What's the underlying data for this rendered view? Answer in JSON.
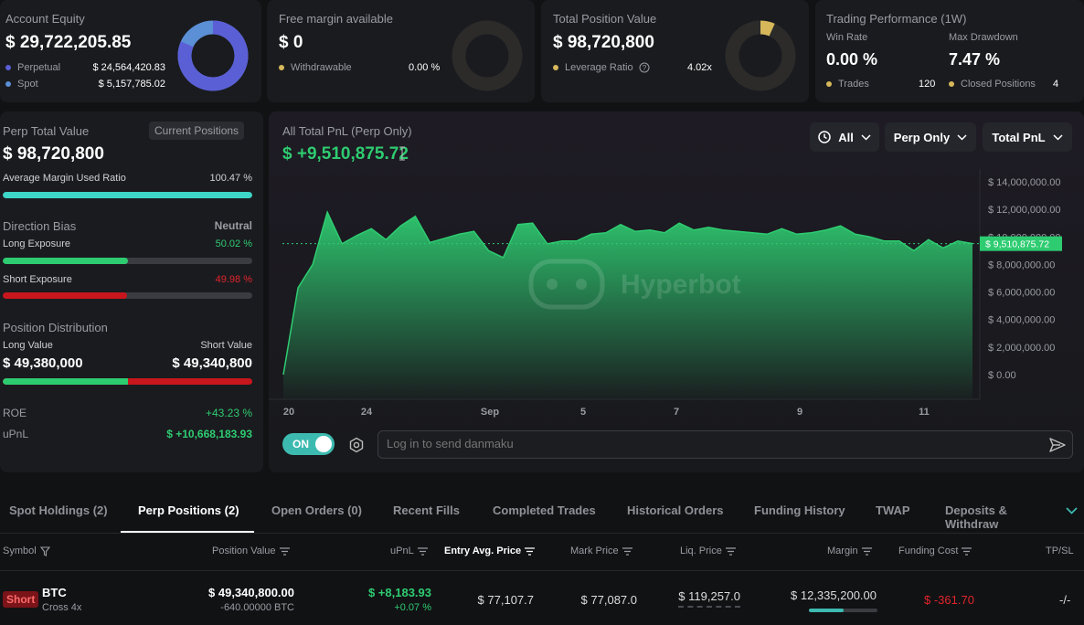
{
  "equity": {
    "title": "Account Equity",
    "value": "$ 29,722,205.85",
    "perp_label": "Perpetual",
    "perp_value": "$ 24,564,420.83",
    "spot_label": "Spot",
    "spot_value": "$ 5,157,785.02",
    "perp_fraction": 0.826,
    "perp_color": "#5b5fd6",
    "spot_color": "#5b8fd6"
  },
  "margin": {
    "title": "Free margin available",
    "value": "$ 0",
    "withdrawable_label": "Withdrawable",
    "withdrawable_value": "0.00 %"
  },
  "position_value": {
    "title": "Total Position Value",
    "value": "$ 98,720,800",
    "leverage_label": "Leverage Ratio",
    "leverage_value": "4.02x"
  },
  "performance": {
    "title": "Trading Performance (1W)",
    "win_rate_label": "Win Rate",
    "win_rate_value": "0.00 %",
    "drawdown_label": "Max Drawdown",
    "drawdown_value": "7.47 %",
    "trades_label": "Trades",
    "trades_value": "120",
    "closed_label": "Closed Positions",
    "closed_value": "4"
  },
  "perp": {
    "title": "Perp Total Value",
    "current_positions": "Current Positions",
    "value": "$ 98,720,800",
    "avg_margin_label": "Average Margin Used Ratio",
    "avg_margin_value": "100.47 %",
    "avg_margin_fraction": 1.0,
    "direction_label": "Direction Bias",
    "direction_value": "Neutral",
    "long_label": "Long Exposure",
    "long_value": "50.02 %",
    "long_fraction": 0.5002,
    "short_label": "Short Exposure",
    "short_value": "49.98 %",
    "short_fraction": 0.4998,
    "distribution_label": "Position Distribution",
    "long_value_label": "Long Value",
    "short_value_label": "Short Value",
    "long_amount": "$ 49,380,000",
    "short_amount": "$ 49,340,800",
    "roe_label": "ROE",
    "roe_value": "+43.23 %",
    "upnl_label": "uPnL",
    "upnl_value": "$ +10,668,183.93"
  },
  "pnl": {
    "title": "All Total PnL (Perp Only)",
    "value": "$ +9,510,875.72",
    "filter_all": "All",
    "filter_perp": "Perp Only",
    "filter_total": "Total PnL",
    "watermark": "Hyperbot",
    "current_label": "$ 9,510,875.72"
  },
  "danmaku": {
    "toggle": "ON",
    "placeholder": "Log in to send danmaku"
  },
  "tabs": [
    "Spot Holdings (2)",
    "Perp Positions (2)",
    "Open Orders (0)",
    "Recent Fills",
    "Completed Trades",
    "Historical Orders",
    "Funding History",
    "TWAP",
    "Deposits & Withdraw"
  ],
  "table": {
    "headers": [
      "Symbol",
      "Position Value",
      "uPnL",
      "Entry Avg. Price",
      "Mark Price",
      "Liq. Price",
      "Margin",
      "Funding Cost",
      "TP/SL"
    ],
    "row": {
      "side": "Short",
      "symbol": "BTC",
      "mode": "Cross 4x",
      "pos_value": "$ 49,340,800.00",
      "pos_size": "-640.00000 BTC",
      "upnl": "$ +8,183.93",
      "upnl_pct": "+0.07 %",
      "entry": "$ 77,107.7",
      "mark": "$ 77,087.0",
      "liq": "$ 119,257.0",
      "margin": "$ 12,335,200.00",
      "margin_fraction": 0.5,
      "funding": "$ -361.70",
      "tpsl": "-/-"
    }
  },
  "chart_data": {
    "type": "area",
    "title": "All Total PnL (Perp Only)",
    "x_ticks": [
      "20",
      "24",
      "Sep",
      "5",
      "7",
      "9",
      "11"
    ],
    "y_ticks": [
      "$ 0.00",
      "$ 2,000,000.00",
      "$ 4,000,000.00",
      "$ 6,000,000.00",
      "$ 8,000,000.00",
      "$ 10,000,000.00",
      "$ 12,000,000.00",
      "$ 14,000,000.00"
    ],
    "ylim": [
      0,
      14000000
    ],
    "series": [
      {
        "values": [
          0,
          6300000,
          8000000,
          11800000,
          9500000,
          10100000,
          10600000,
          9800000,
          10800000,
          11500000,
          9600000,
          9900000,
          10200000,
          10400000,
          9000000,
          8500000,
          10900000,
          11000000,
          9500000,
          9700000,
          9700000,
          10200000,
          10300000,
          10900000,
          10400000,
          10500000,
          10300000,
          11000000,
          10500000,
          10700000,
          10500000,
          10400000,
          10300000,
          10200000,
          10600000,
          10200000,
          10300000,
          10500000,
          10800000,
          10200000,
          10000000,
          9700000,
          9700000,
          9000000,
          9800000,
          9200000,
          9700000,
          9510875
        ]
      }
    ],
    "current_value": 9510875.72,
    "color": "#2ecc71"
  }
}
